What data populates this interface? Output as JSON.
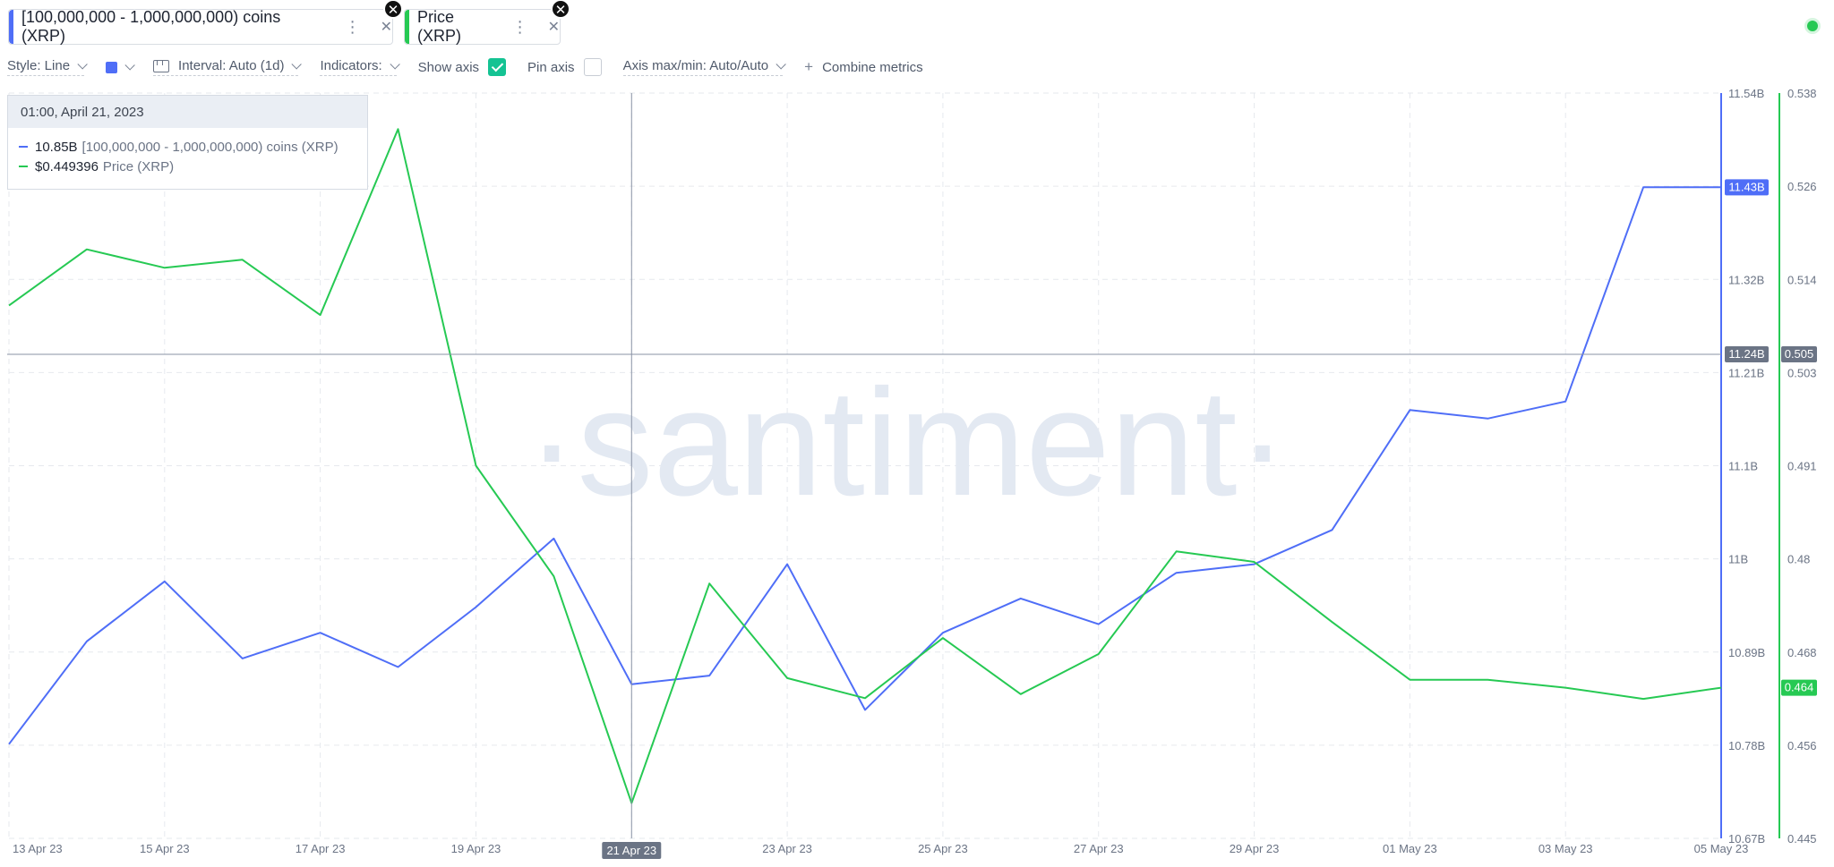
{
  "metrics": [
    {
      "label": "[100,000,000 - 1,000,000,000) coins (XRP)",
      "color": "#4f6ef7"
    },
    {
      "label": "Price (XRP)",
      "color": "#26c953"
    }
  ],
  "toolbar": {
    "style": "Style: Line",
    "interval": "Interval: Auto (1d)",
    "indicators": "Indicators:",
    "show_axis": "Show axis",
    "pin_axis": "Pin axis",
    "axis_maxmin": "Axis max/min: Auto/Auto",
    "combine": "Combine metrics"
  },
  "tooltip": {
    "date": "01:00, April 21, 2023",
    "rows": [
      {
        "value": "10.85B",
        "label": "[100,000,000 - 1,000,000,000) coins (XRP)",
        "color": "#4f6ef7"
      },
      {
        "value": "$0.449396",
        "label": "Price (XRP)",
        "color": "#26c953"
      }
    ]
  },
  "watermark": "·santiment·",
  "crosshair": {
    "x_label": "21 Apr 23",
    "y_left_label": "11.24B",
    "y_right_label": "0.505"
  },
  "last_value_labels": {
    "supply": "11.43B",
    "price": "0.464"
  },
  "chart_data": {
    "type": "line",
    "x": [
      "13 Apr 23",
      "14 Apr 23",
      "15 Apr 23",
      "16 Apr 23",
      "17 Apr 23",
      "18 Apr 23",
      "19 Apr 23",
      "20 Apr 23",
      "21 Apr 23",
      "22 Apr 23",
      "23 Apr 23",
      "24 Apr 23",
      "25 Apr 23",
      "26 Apr 23",
      "27 Apr 23",
      "28 Apr 23",
      "29 Apr 23",
      "30 Apr 23",
      "01 May 23",
      "02 May 23",
      "03 May 23",
      "04 May 23",
      "05 May 23"
    ],
    "x_tick_labels": [
      "13 Apr 23",
      "15 Apr 23",
      "17 Apr 23",
      "19 Apr 23",
      "21 Apr 23",
      "23 Apr 23",
      "25 Apr 23",
      "27 Apr 23",
      "29 Apr 23",
      "01 May 23",
      "03 May 23",
      "05 May 23"
    ],
    "series": [
      {
        "name": "[100,000,000 - 1,000,000,000) coins (XRP)",
        "color": "#4f6ef7",
        "axis": "left",
        "values": [
          10.78,
          10.9,
          10.97,
          10.88,
          10.91,
          10.87,
          10.94,
          11.02,
          10.85,
          10.86,
          10.99,
          10.82,
          10.91,
          10.95,
          10.92,
          10.98,
          10.99,
          11.03,
          11.17,
          11.16,
          11.18,
          11.43,
          11.43
        ]
      },
      {
        "name": "Price (XRP)",
        "color": "#26c953",
        "axis": "right",
        "values": [
          0.5115,
          0.5185,
          0.5162,
          0.5172,
          0.5103,
          0.5335,
          0.4915,
          0.4777,
          0.4494,
          0.4768,
          0.465,
          0.4625,
          0.47,
          0.463,
          0.468,
          0.4808,
          0.4795,
          0.472,
          0.4648,
          0.4648,
          0.4638,
          0.4624,
          0.4638
        ]
      }
    ],
    "y_left": {
      "ticks": [
        "11.54B",
        "11.43B",
        "11.32B",
        "11.21B",
        "11.1B",
        "11B",
        "10.89B",
        "10.78B",
        "10.67B"
      ],
      "range": [
        10.67,
        11.54
      ]
    },
    "y_right": {
      "ticks": [
        "0.538",
        "0.526",
        "0.514",
        "0.503",
        "0.491",
        "0.48",
        "0.468",
        "0.456",
        "0.445"
      ],
      "range": [
        0.445,
        0.538
      ]
    },
    "grid": true
  }
}
